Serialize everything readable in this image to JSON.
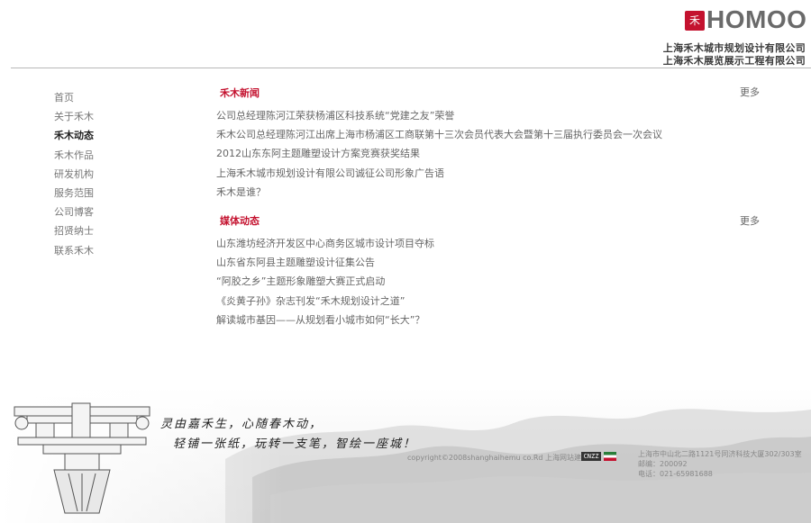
{
  "header": {
    "logo_mark": "禾",
    "logo_text": "HOMOO",
    "company_1": "上海禾木城市规划设计有限公司",
    "company_2": "上海禾木展览展示工程有限公司",
    "accent_color": "#c4122f"
  },
  "sidebar": {
    "items": [
      {
        "label": "首页"
      },
      {
        "label": "关于禾木"
      },
      {
        "label": "禾木动态"
      },
      {
        "label": "禾木作品"
      },
      {
        "label": "研发机构"
      },
      {
        "label": "服务范围"
      },
      {
        "label": "公司博客"
      },
      {
        "label": "招贤纳士"
      },
      {
        "label": "联系禾木"
      }
    ],
    "active": "禾木动态"
  },
  "sections": [
    {
      "title": "禾木新闻",
      "more": "更多",
      "items": [
        "公司总经理陈河江荣获杨浦区科技系统“党建之友”荣誉",
        "禾木公司总经理陈河江出席上海市杨浦区工商联第十三次会员代表大会暨第十三届执行委员会一次会议",
        "2012山东东阿主题雕塑设计方案竞赛获奖结果",
        "上海禾木城市规划设计有限公司诚征公司形象广告语",
        "禾木是谁？"
      ]
    },
    {
      "title": "媒体动态",
      "more": "更多",
      "items": [
        "山东潍坊经济开发区中心商务区城市设计项目夺标",
        "山东省东阿县主题雕塑设计征集公告",
        "“阿胶之乡”主题形象雕塑大赛正式启动",
        "《炎黄子孙》杂志刊发“禾木规划设计之道”",
        "解读城市基因——从规划看小城市如何“长大”？"
      ]
    }
  ],
  "footer": {
    "slogan_1": "灵由嘉禾生，心随春木动，",
    "slogan_2": "轻铺一张纸，玩转一支笔，智绘一座城！",
    "copyright": "copyright©2008shanghaihemu co.Rd  上海网站建设",
    "badge": "CNZZ",
    "address": "上海市中山北二路1121号同济科技大厦302/303室",
    "postcode": "邮编：200092",
    "phone": "电话：021-65981688"
  }
}
